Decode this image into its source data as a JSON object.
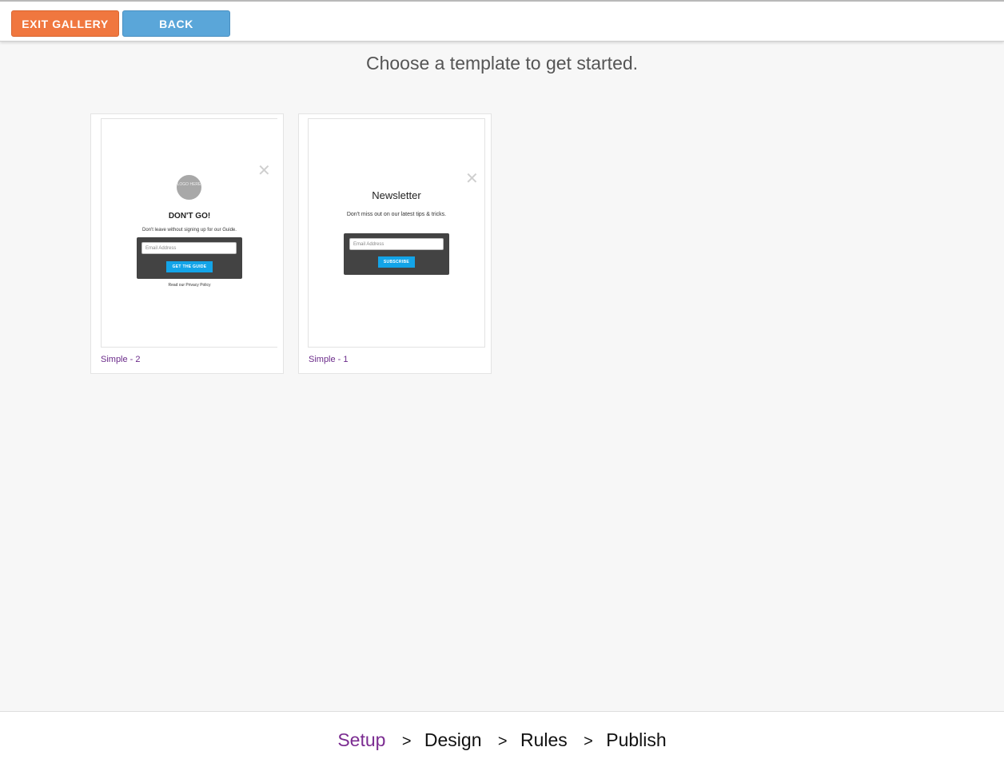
{
  "toolbar": {
    "exit_label": "EXIT GALLERY",
    "back_label": "BACK"
  },
  "heading": "Choose a template to get started.",
  "templates": [
    {
      "label": "Simple - 2",
      "preview": {
        "logo_text": "LOGO HERE",
        "title": "DON'T GO!",
        "text": "Don't leave without signing up for our Guide.",
        "email_placeholder": "Email Address",
        "button": "GET THE GUIDE",
        "privacy": "Read our Privacy Policy",
        "close": "✕"
      }
    },
    {
      "label": "Simple - 1",
      "preview": {
        "title": "Newsletter",
        "text": "Don't miss out on our latest tips & tricks.",
        "email_placeholder": "Email Address",
        "button": "SUBSCRIBE",
        "close": "✕"
      }
    }
  ],
  "steps": {
    "setup": "Setup",
    "design": "Design",
    "rules": "Rules",
    "publish": "Publish",
    "separator": ">"
  },
  "colors": {
    "exit_button": "#f0773f",
    "back_button": "#5aa6d9",
    "active_step": "#7b2c91",
    "cta_blue": "#13a4e8"
  }
}
